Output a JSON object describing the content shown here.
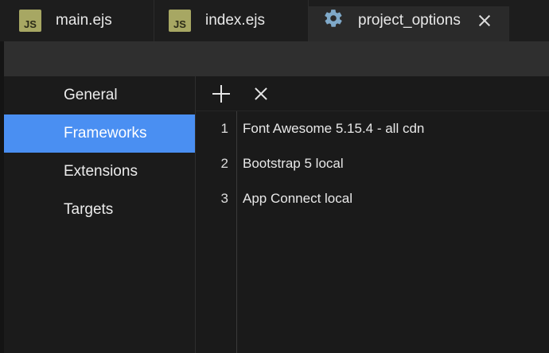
{
  "tabs": [
    {
      "label": "main.ejs",
      "icon": "js-file-icon",
      "icon_text": "JS"
    },
    {
      "label": "index.ejs",
      "icon": "js-file-icon",
      "icon_text": "JS"
    },
    {
      "label": "project_options",
      "icon": "gear-icon",
      "active": true
    }
  ],
  "sidebar": {
    "items": [
      {
        "label": "General"
      },
      {
        "label": "Frameworks",
        "active": true
      },
      {
        "label": "Extensions"
      },
      {
        "label": "Targets"
      }
    ]
  },
  "toolbar": {
    "add_icon": "plus-icon",
    "remove_icon": "x-icon"
  },
  "frameworks": [
    {
      "num": "1",
      "name": "Font Awesome 5.15.4 - all cdn"
    },
    {
      "num": "2",
      "name": "Bootstrap 5 local"
    },
    {
      "num": "3",
      "name": "App Connect local"
    }
  ],
  "colors": {
    "accent": "#4a8ff2",
    "js_icon": "#a7a763"
  }
}
